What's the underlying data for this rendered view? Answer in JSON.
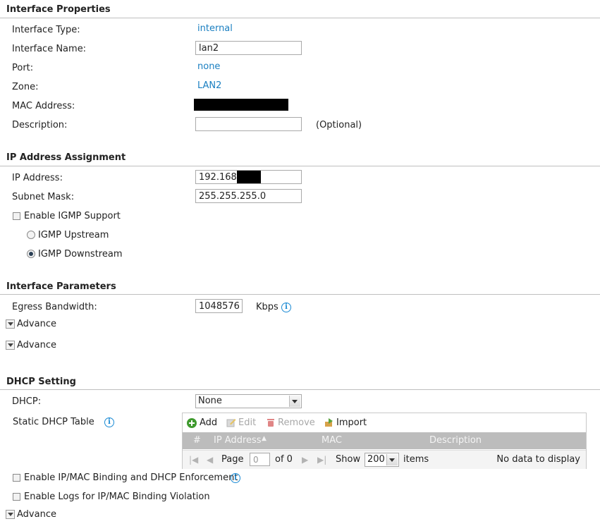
{
  "interface_properties": {
    "title": "Interface Properties",
    "type_label": "Interface Type:",
    "type_value": "internal",
    "name_label": "Interface Name:",
    "name_value": "lan2",
    "port_label": "Port:",
    "port_value": "none",
    "zone_label": "Zone:",
    "zone_value": "LAN2",
    "mac_label": "MAC Address:",
    "description_label": "Description:",
    "description_value": "",
    "optional_note": "(Optional)"
  },
  "ip_assignment": {
    "title": "IP Address Assignment",
    "ip_label": "IP Address:",
    "ip_value": "192.168.",
    "subnet_label": "Subnet Mask:",
    "subnet_value": "255.255.255.0",
    "igmp_support_label": "Enable IGMP Support",
    "igmp_support_checked": false,
    "igmp_upstream_label": "IGMP Upstream",
    "igmp_downstream_label": "IGMP Downstream",
    "igmp_selected": "downstream"
  },
  "interface_parameters": {
    "title": "Interface Parameters",
    "egress_label": "Egress Bandwidth:",
    "egress_value": "1048576",
    "egress_unit": "Kbps",
    "advance_1": "Advance",
    "advance_2": "Advance"
  },
  "dhcp": {
    "title": "DHCP Setting",
    "dhcp_label": "DHCP:",
    "dhcp_value": "None",
    "static_table_label": "Static DHCP Table",
    "toolbar": {
      "add": "Add",
      "edit": "Edit",
      "remove": "Remove",
      "import": "Import"
    },
    "columns": {
      "index": "#",
      "ip": "IP Address",
      "mac": "MAC",
      "description": "Description"
    },
    "pager": {
      "page_label": "Page",
      "page_value": "0",
      "of_label": "of 0",
      "show_label": "Show",
      "show_value": "200",
      "items_label": "items",
      "empty_message": "No data to display"
    },
    "ipmac_binding_label": "Enable IP/MAC Binding and DHCP Enforcement",
    "ipmac_logs_label": "Enable Logs for IP/MAC Binding Violation",
    "advance_3": "Advance"
  },
  "colors": {
    "link": "#1a7fc1",
    "info_icon": "#1a8ad4",
    "grid_header": "#bcbcbc",
    "add_icon": "#3f9a2e",
    "remove_icon": "#e08585"
  }
}
